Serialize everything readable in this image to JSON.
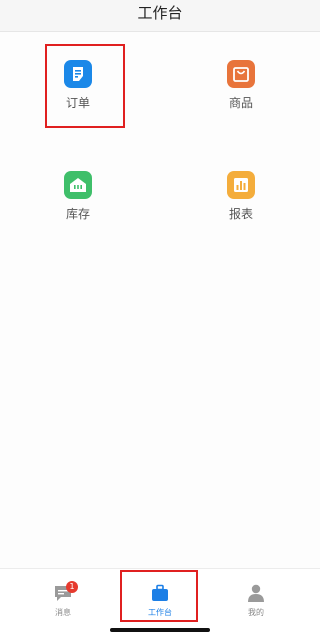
{
  "header": {
    "title": "工作台"
  },
  "grid": {
    "items": [
      {
        "label": "订单",
        "icon": "order-icon",
        "color": "#1b88e8"
      },
      {
        "label": "商品",
        "icon": "shopping-bag-icon",
        "color": "#e8743b"
      },
      {
        "label": "库存",
        "icon": "warehouse-icon",
        "color": "#3fbf6a"
      },
      {
        "label": "报表",
        "icon": "report-chart-icon",
        "color": "#f4ad3c"
      }
    ]
  },
  "tabbar": {
    "tabs": [
      {
        "label": "消息",
        "icon": "message-icon",
        "badge": "1",
        "active": false
      },
      {
        "label": "工作台",
        "icon": "briefcase-icon",
        "active": true
      },
      {
        "label": "我的",
        "icon": "profile-icon",
        "active": false
      }
    ]
  },
  "colors": {
    "highlight": "#e02020",
    "active_tab": "#1c7fe6",
    "badge": "#e63a2e"
  }
}
